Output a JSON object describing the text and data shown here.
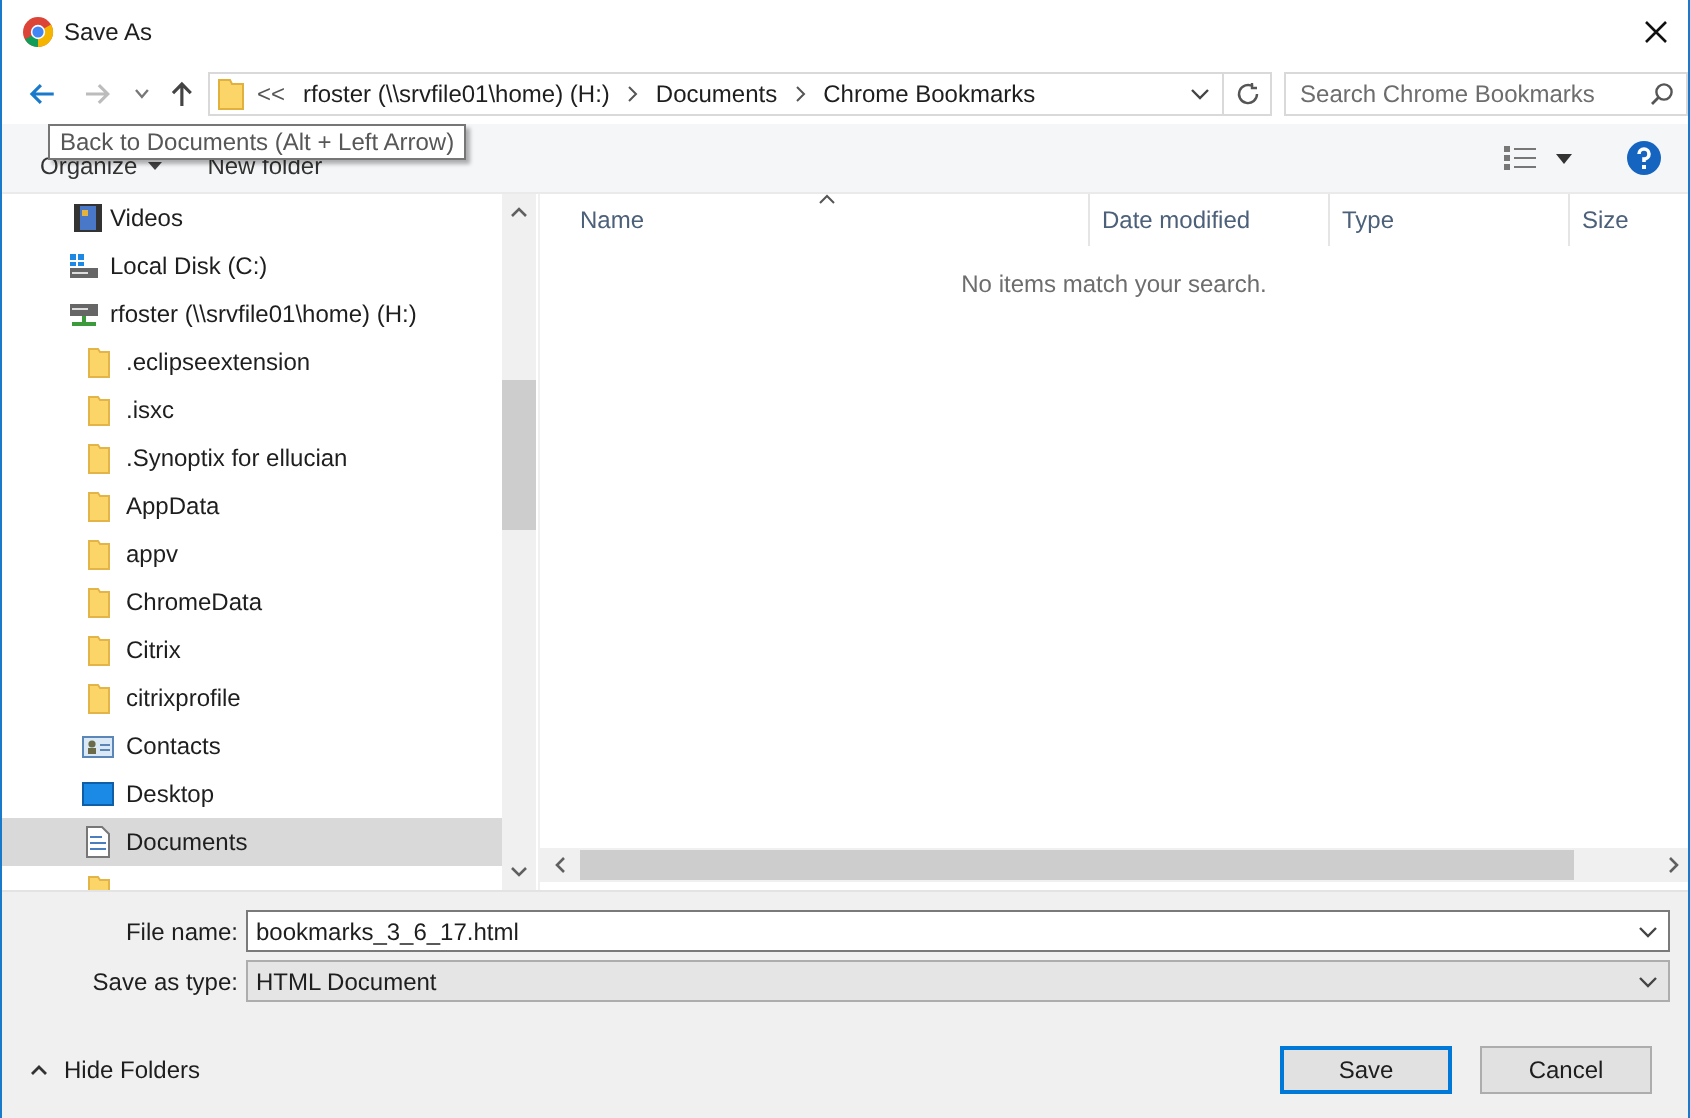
{
  "window": {
    "title": "Save As"
  },
  "address_bar": {
    "overflow": "<<",
    "crumbs": [
      "rfoster (\\\\srvfile01\\home) (H:)",
      "Documents",
      "Chrome Bookmarks"
    ]
  },
  "search": {
    "placeholder": "Search Chrome Bookmarks"
  },
  "tooltip": "Back to Documents (Alt + Left Arrow)",
  "toolbar": {
    "organize": "Organize",
    "new_folder": "New folder"
  },
  "sidebar": {
    "items": [
      {
        "label": "Videos",
        "kind": "videos",
        "selected": false
      },
      {
        "label": "Local Disk (C:)",
        "kind": "disk",
        "selected": false
      },
      {
        "label": "rfoster (\\\\srvfile01\\home) (H:)",
        "kind": "network-drive",
        "selected": false,
        "children": [
          {
            "label": ".eclipseextension",
            "kind": "folder",
            "selected": false
          },
          {
            "label": ".isxc",
            "kind": "folder",
            "selected": false
          },
          {
            "label": ".Synoptix for ellucian",
            "kind": "folder",
            "selected": false
          },
          {
            "label": "AppData",
            "kind": "folder",
            "selected": false
          },
          {
            "label": "appv",
            "kind": "folder",
            "selected": false
          },
          {
            "label": "ChromeData",
            "kind": "folder",
            "selected": false
          },
          {
            "label": "Citrix",
            "kind": "folder",
            "selected": false
          },
          {
            "label": "citrixprofile",
            "kind": "folder",
            "selected": false
          },
          {
            "label": "Contacts",
            "kind": "contacts",
            "selected": false
          },
          {
            "label": "Desktop",
            "kind": "desktop",
            "selected": false
          },
          {
            "label": "Documents",
            "kind": "documents",
            "selected": true
          }
        ]
      }
    ]
  },
  "table": {
    "columns": [
      "Name",
      "Date modified",
      "Type",
      "Size"
    ],
    "empty_message": "No items match your search."
  },
  "form": {
    "file_name_label": "File name:",
    "file_name": "bookmarks_3_6_17.html",
    "type_label": "Save as type:",
    "type": "HTML Document"
  },
  "hide_folders": "Hide Folders",
  "buttons": [
    "Save",
    "Cancel"
  ]
}
